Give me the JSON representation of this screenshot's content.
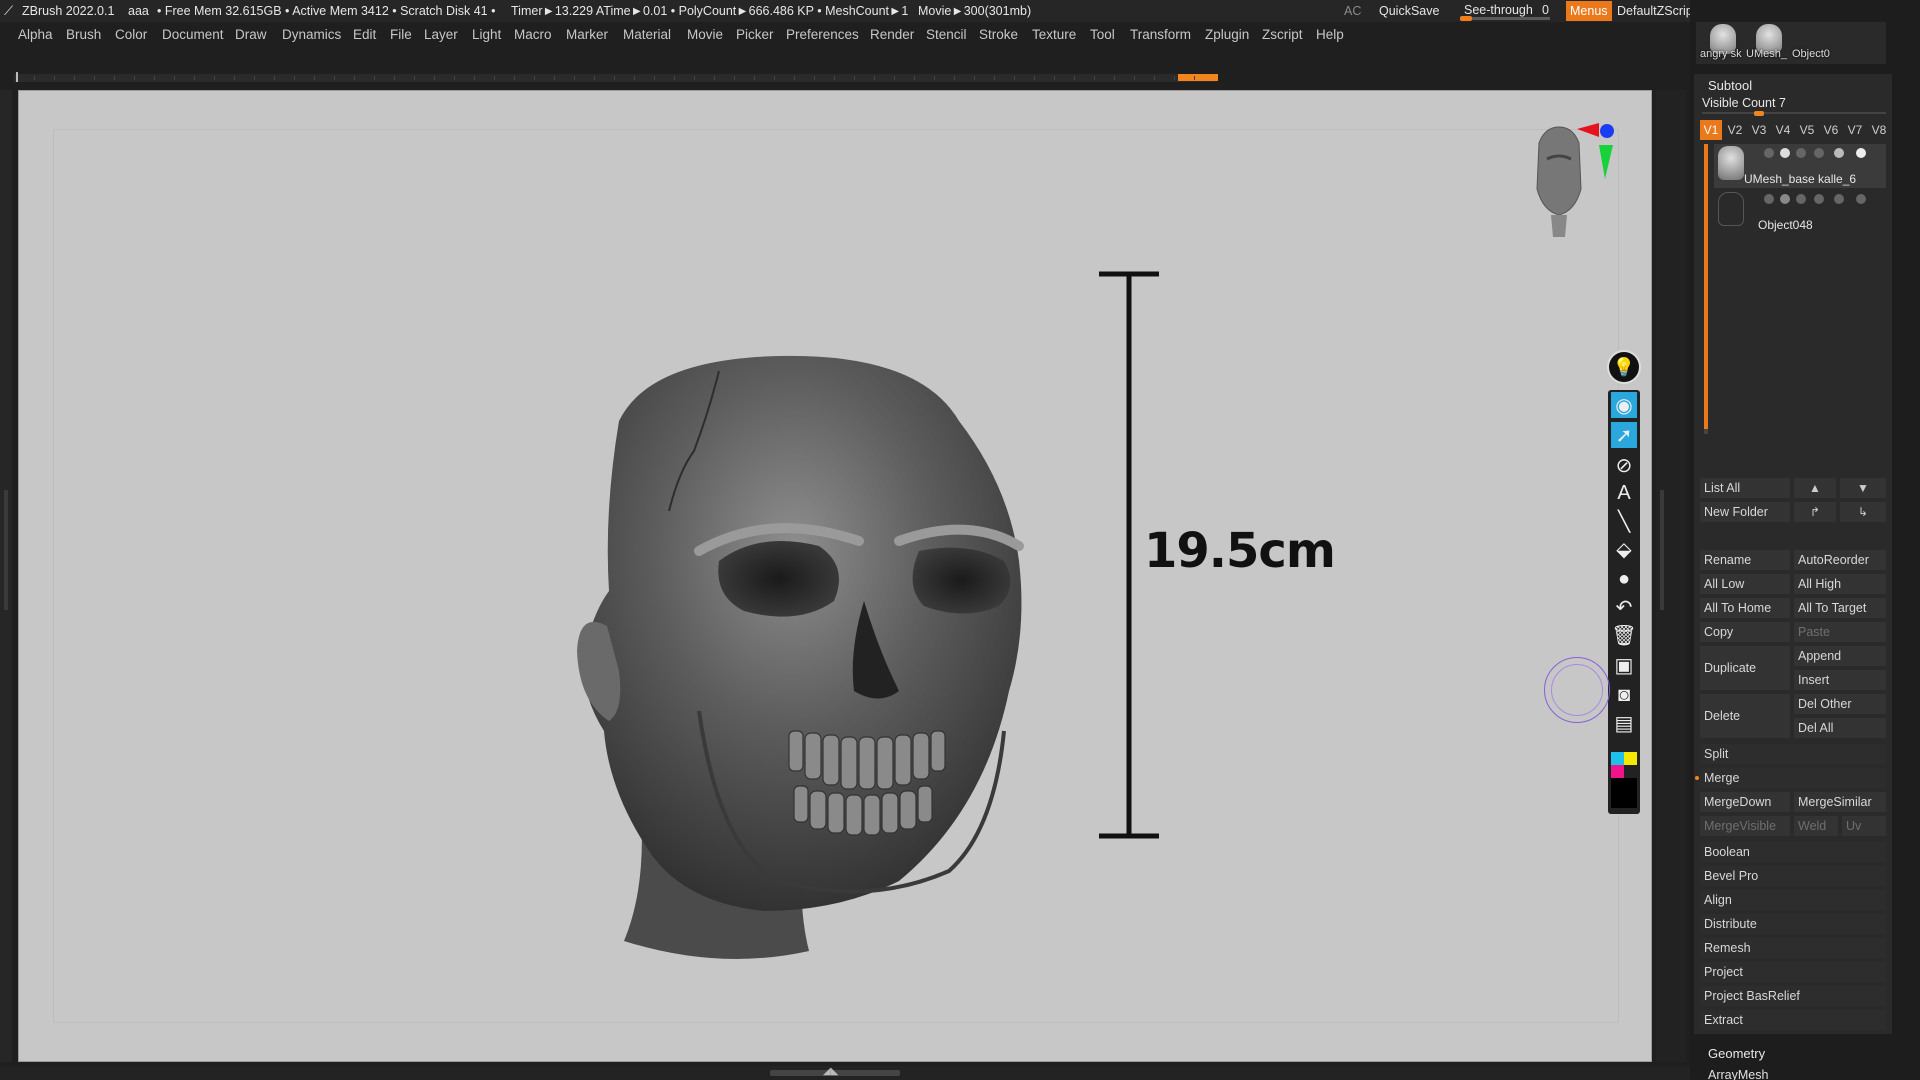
{
  "status_bar": {
    "app_title": "ZBrush 2022.0.1",
    "doc_name": "aaa",
    "free_mem": "• Free Mem 32.615GB • Active Mem 3412 • Scratch Disk 41 •",
    "timer": "Timer►13.229 ATime►0.01 • PolyCount►666.486 KP • MeshCount►1",
    "movie": "Movie►300(301mb)",
    "ac": "AC",
    "quicksave": "QuickSave",
    "see_through_label": "See-through",
    "see_through_value": "0",
    "menus": "Menus",
    "default_zscript": "DefaultZScript"
  },
  "menu_bar": [
    "Alpha",
    "Brush",
    "Color",
    "Document",
    "Draw",
    "Dynamics",
    "Edit",
    "File",
    "Layer",
    "Light",
    "Macro",
    "Marker",
    "Material",
    "Movie",
    "Picker",
    "Preferences",
    "Render",
    "Stencil",
    "Stroke",
    "Texture",
    "Tool",
    "Transform",
    "Zplugin",
    "Zscript",
    "Help"
  ],
  "canvas": {
    "measurement_label": "19.5cm",
    "bg_color": "#c7c7c7"
  },
  "tray_thumbs": [
    {
      "label": "angry sk"
    },
    {
      "label": "UMesh_"
    },
    {
      "label": "Object0"
    }
  ],
  "subtool": {
    "title": "Subtool",
    "visible_count": "Visible Count 7",
    "visibility_sets": [
      "V1",
      "V2",
      "V3",
      "V4",
      "V5",
      "V6",
      "V7",
      "V8"
    ],
    "active_set": "V1",
    "items": [
      {
        "name": "UMesh_base kalle_6",
        "selected": true
      },
      {
        "name": "Object048",
        "selected": false
      }
    ],
    "buttons": {
      "list_all": "List All",
      "new_folder": "New Folder",
      "rename": "Rename",
      "auto_reorder": "AutoReorder",
      "all_low": "All Low",
      "all_high": "All High",
      "all_to_home": "All To Home",
      "all_to_target": "All To Target",
      "copy": "Copy",
      "paste": "Paste",
      "duplicate": "Duplicate",
      "append": "Append",
      "insert": "Insert",
      "delete": "Delete",
      "del_other": "Del Other",
      "del_all": "Del All",
      "split": "Split",
      "merge": "Merge",
      "merge_down": "MergeDown",
      "merge_similar": "MergeSimilar",
      "merge_visible": "MergeVisible",
      "weld": "Weld",
      "uv": "Uv",
      "boolean": "Boolean",
      "bevel_pro": "Bevel Pro",
      "align": "Align",
      "distribute": "Distribute",
      "remesh": "Remesh",
      "project": "Project",
      "project_basrelief": "Project BasRelief",
      "extract": "Extract"
    }
  },
  "geometry": {
    "title": "Geometry",
    "arraymesh": "ArrayMesh"
  },
  "colors": {
    "accent": "#e9791a",
    "active_tool": "#2aa7dd",
    "panel_bg": "#2a2a2a"
  }
}
